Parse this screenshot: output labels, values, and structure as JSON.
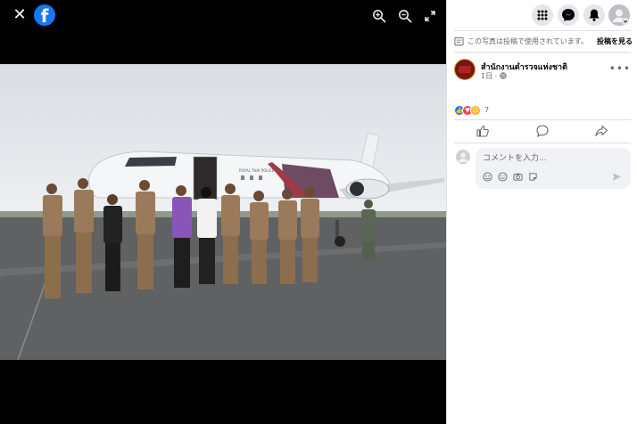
{
  "viewer": {
    "close_icon": "close-icon",
    "logo_icon": "facebook-logo",
    "logo_letter": "f",
    "tools": [
      "zoom-in-icon",
      "zoom-out-icon",
      "fullscreen-icon"
    ]
  },
  "photo": {
    "aircraft_label": "ROYAL THAI POLICE"
  },
  "header": {
    "buttons": [
      "menu-grid-icon",
      "messenger-icon",
      "notifications-icon",
      "profile-avatar"
    ]
  },
  "notice": {
    "text": "この写真は投稿で使用されています。",
    "link": "投稿を見る"
  },
  "post": {
    "page_name": "สำนักงานตำรวจแห่งชาติ",
    "time": "1日 · ",
    "reaction_count": "7",
    "reactions": [
      "like",
      "love",
      "care"
    ]
  },
  "comment": {
    "placeholder": "コメントを入力..."
  },
  "colors": {
    "facebook_blue": "#1877f2",
    "viewer_bg": "#000000",
    "like": "#1877f2",
    "love": "#f33e58",
    "care": "#f7b125"
  }
}
